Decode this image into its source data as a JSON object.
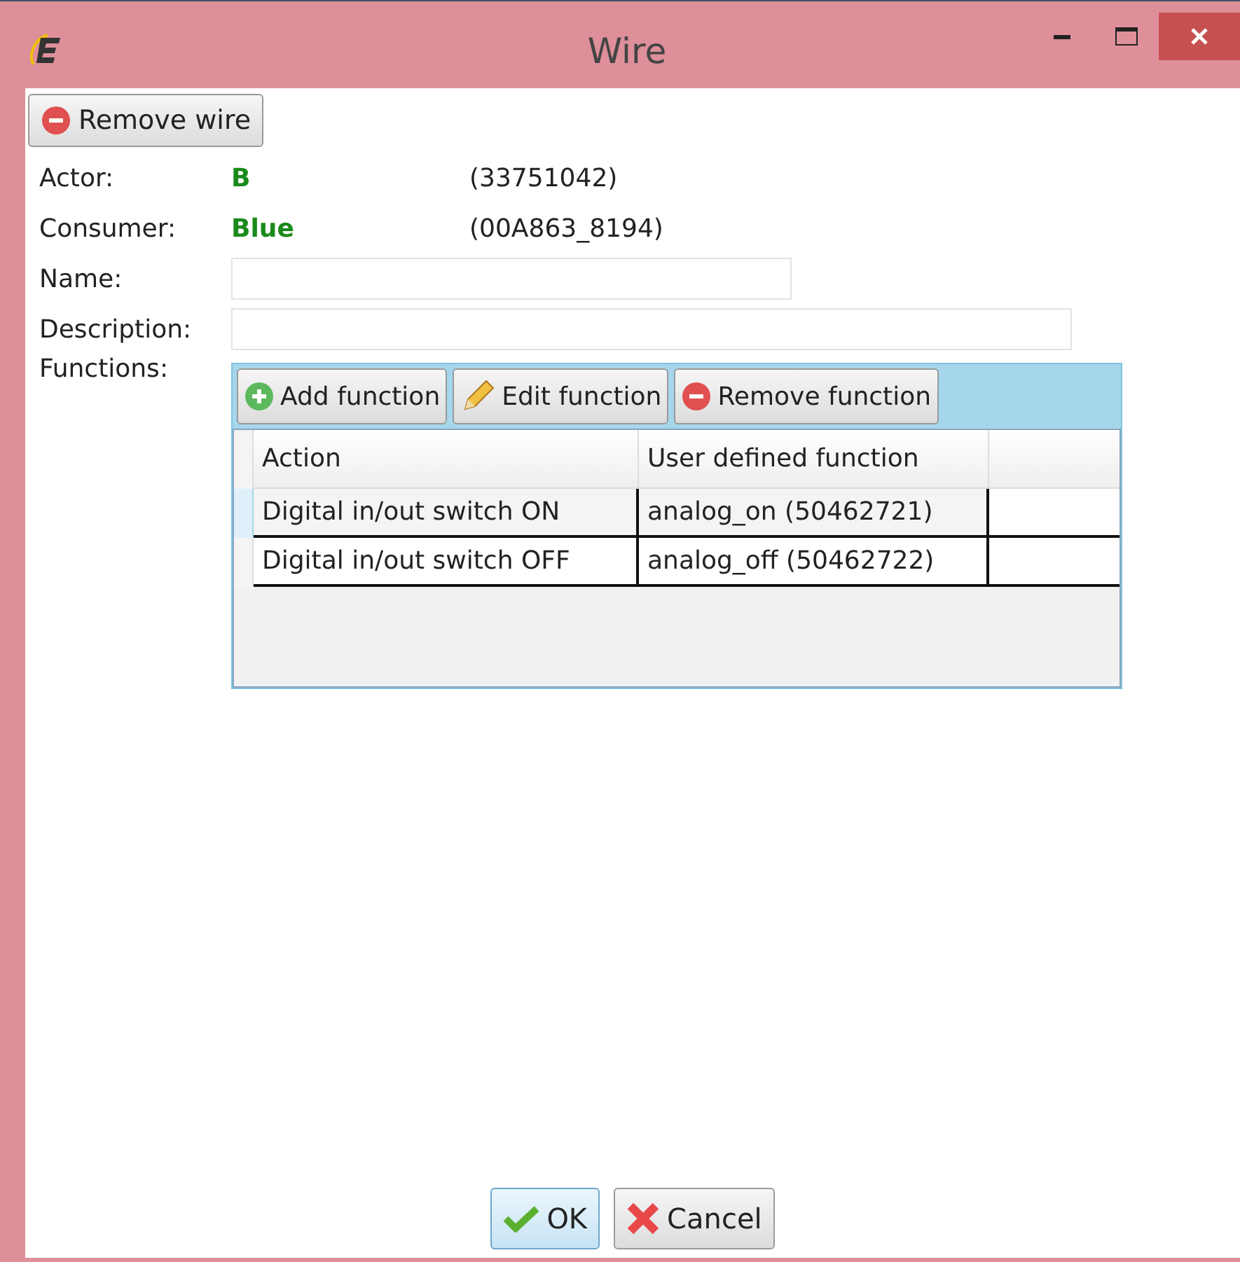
{
  "window": {
    "title": "Wire"
  },
  "remove_button": {
    "label": "Remove wire"
  },
  "fields": [
    {
      "kind": "info",
      "label": "Actor:",
      "value": "B",
      "id": "(33751042)"
    },
    {
      "kind": "info",
      "label": "Consumer:",
      "value": "Blue",
      "id": "(00A863_8194)"
    },
    {
      "kind": "short_input",
      "label": "Name:"
    },
    {
      "kind": "long_input",
      "label": "Description:"
    }
  ],
  "functions": {
    "label": "Functions:",
    "toolbar": [
      {
        "kind": "add",
        "label": "Add function"
      },
      {
        "kind": "edit",
        "label": "Edit function"
      },
      {
        "kind": "remove",
        "label": "Remove function"
      }
    ],
    "columns": [
      "Action",
      "User defined function"
    ],
    "rows": [
      {
        "selected": true,
        "cells": [
          "Digital in/out switch ON",
          "analog_on (50462721)"
        ]
      },
      {
        "selected": false,
        "cells": [
          "Digital in/out switch OFF",
          "analog_off (50462722)"
        ]
      }
    ]
  },
  "buttons": [
    {
      "kind": "ok",
      "label": "OK",
      "default": true
    },
    {
      "kind": "cancel",
      "label": "Cancel",
      "default": false
    }
  ]
}
